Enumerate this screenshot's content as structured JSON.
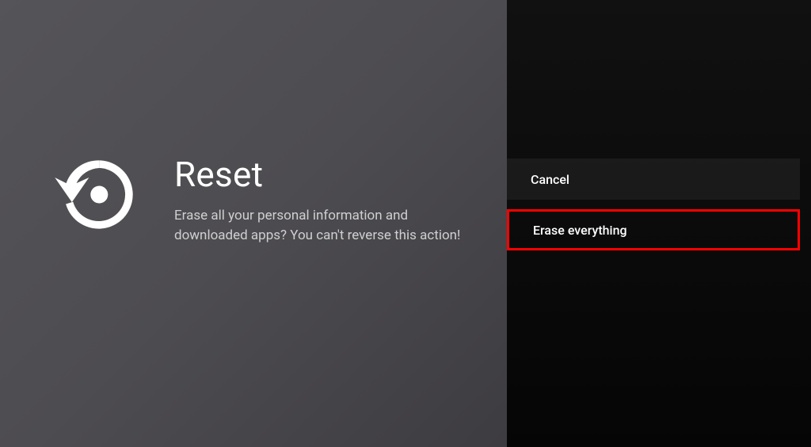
{
  "left": {
    "title": "Reset",
    "description": "Erase all your personal information and downloaded apps? You can't reverse this action!"
  },
  "right": {
    "options": {
      "cancel_label": "Cancel",
      "erase_label": "Erase everything"
    }
  }
}
